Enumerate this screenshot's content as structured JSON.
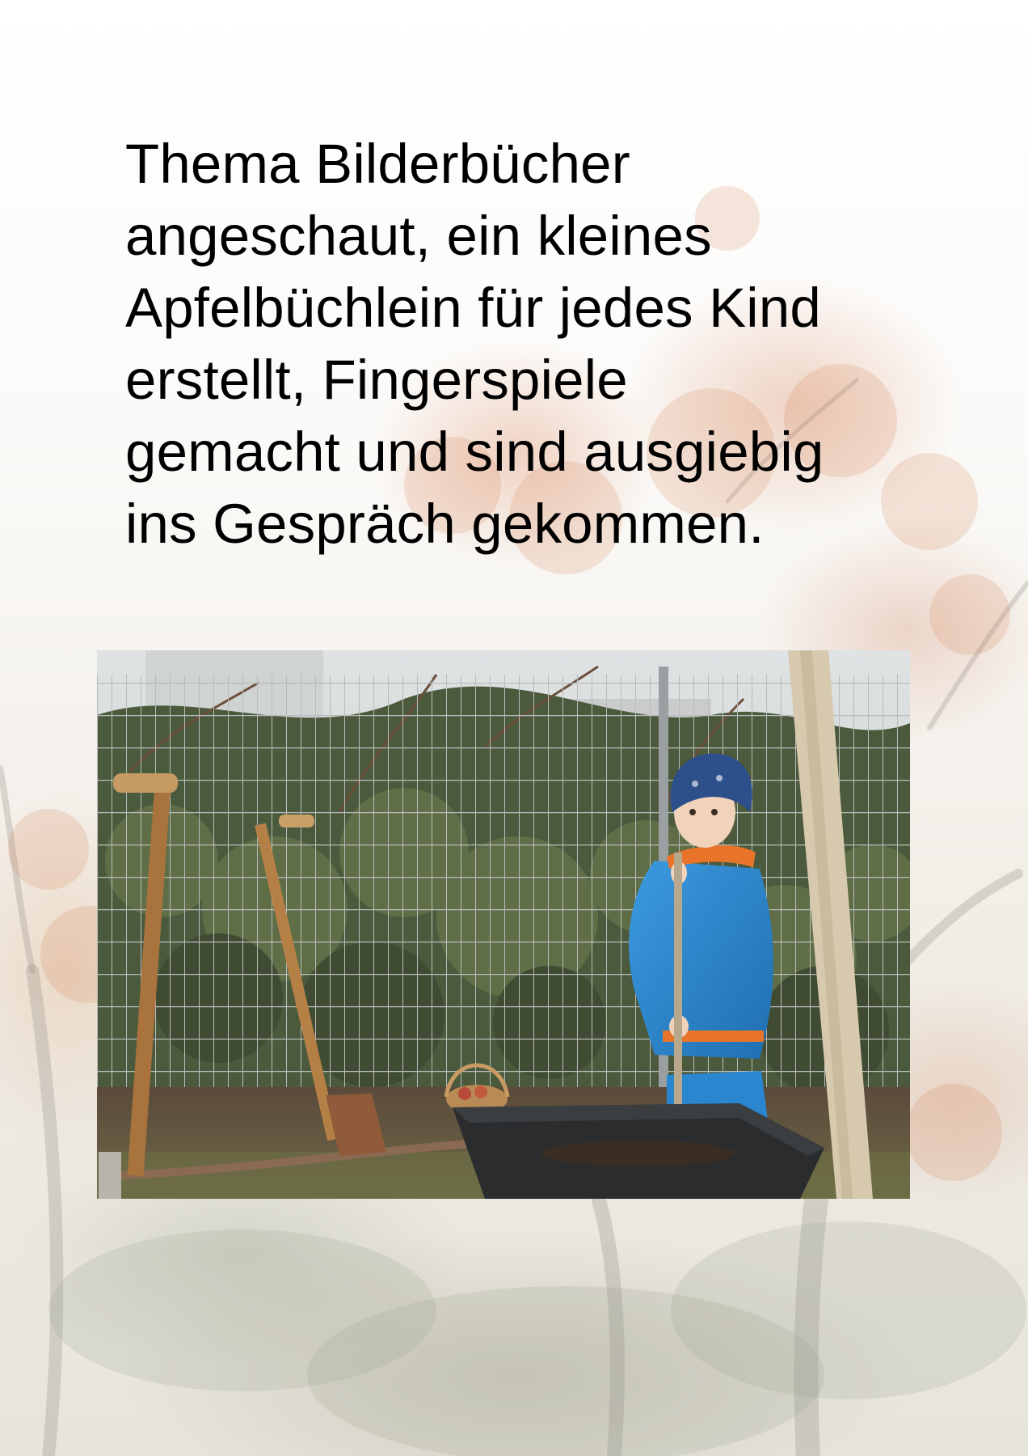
{
  "text": {
    "lines": [
      "Thema Bilderbücher",
      "angeschaut, ein kleines",
      "Apfelbüchlein für jedes Kind",
      "erstellt, Fingerspiele",
      "gemacht und sind ausgiebig",
      "ins Gespräch gekommen."
    ]
  },
  "colors": {
    "text": "#000000",
    "jacket": "#2f8bd0",
    "hat": "#2d4f8a",
    "scarf": "#e8742a"
  }
}
